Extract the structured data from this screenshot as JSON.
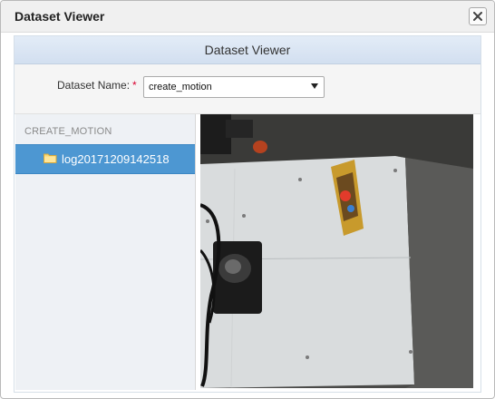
{
  "window": {
    "title": "Dataset Viewer"
  },
  "panel": {
    "header": "Dataset Viewer"
  },
  "form": {
    "label": "Dataset Name:",
    "required_mark": "*",
    "selected": "create_motion"
  },
  "tree": {
    "root": "CREATE_MOTION",
    "items": [
      {
        "label": "log20171209142518",
        "icon": "folder-icon",
        "selected": true
      }
    ]
  },
  "colors": {
    "selected_item": "#4d97d2",
    "required": "#d9002f",
    "panel_header": "#dbe6f3"
  },
  "image": {
    "subject": "camera-frame"
  }
}
